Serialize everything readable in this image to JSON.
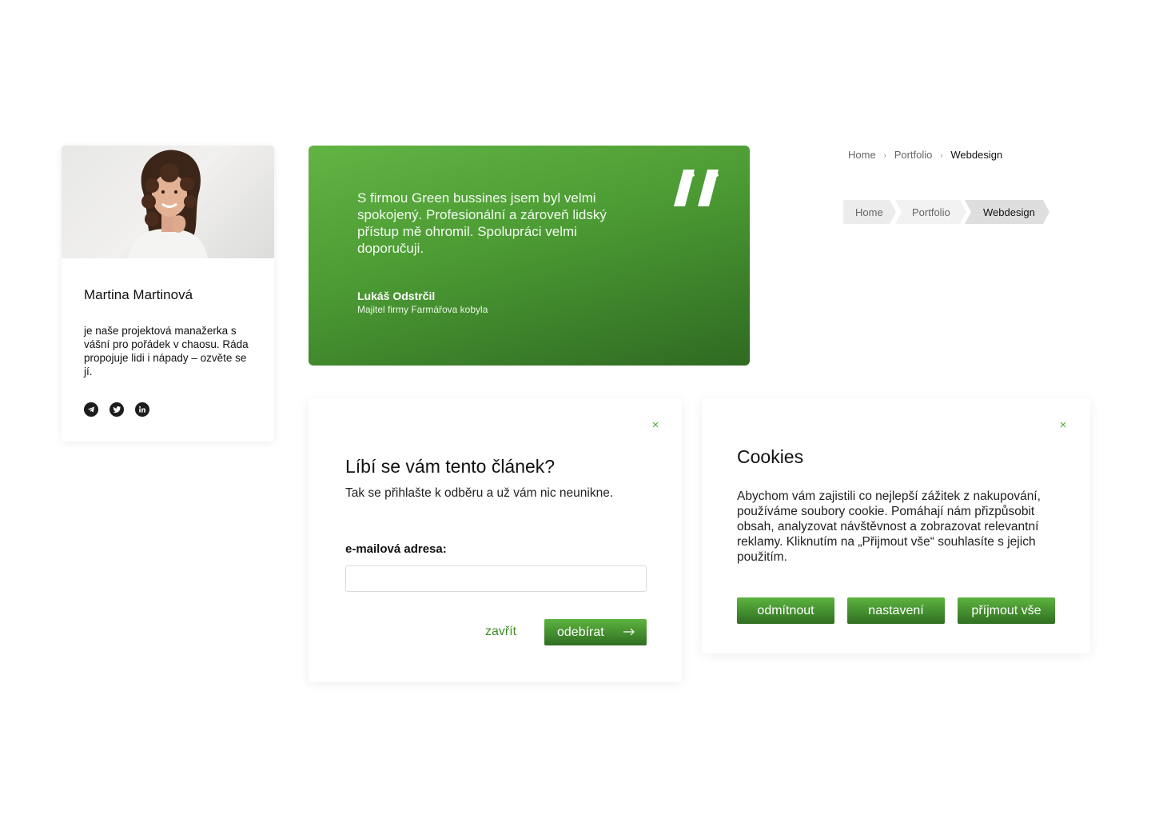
{
  "profile": {
    "name": "Martina Martinová",
    "bio": "je naše projektová manažerka s vášní pro pořádek v chaosu. Ráda propojuje lidi i nápady – ozvěte se jí.",
    "socials": [
      "telegram-icon",
      "twitter-icon",
      "linkedin-icon"
    ]
  },
  "testimonial": {
    "quote": "S firmou Green bussines jsem byl velmi spokojený. Profesionální a zároveň lidský přístup mě ohromil. Spolupráci velmi doporučuji.",
    "author": "Lukáš Odstrčil",
    "role": "Majitel firmy Farmářova kobyla"
  },
  "breadcrumb": {
    "items": [
      "Home",
      "Portfolio",
      "Webdesign"
    ],
    "separator": "›"
  },
  "subscribe": {
    "close": "×",
    "title": "Líbí se vám tento článek?",
    "text": "Tak se přihlašte k odběru a už vám nic neunikne.",
    "email_label": "e-mailová adresa:",
    "email_value": "",
    "close_link": "zavřít",
    "submit": "odebírat",
    "submit_arrow": "⟶"
  },
  "cookies": {
    "close": "×",
    "title": "Cookies",
    "text": "Abychom vám zajistili co nejlepší zážitek z nakupování, používáme soubory cookie. Pomáhají nám přizpůsobit obsah, analyzovat návštěvnost a zobrazovat relevantní reklamy. Kliknutím na „Přijmout vše“ souhlasíte s jejich použitím.",
    "buttons": [
      "odmítnout",
      "nastavení",
      "příjmout vše"
    ]
  },
  "colors": {
    "accent": "#4fae2e",
    "button_top": "#5db33f",
    "button_bottom": "#2f6f22"
  }
}
